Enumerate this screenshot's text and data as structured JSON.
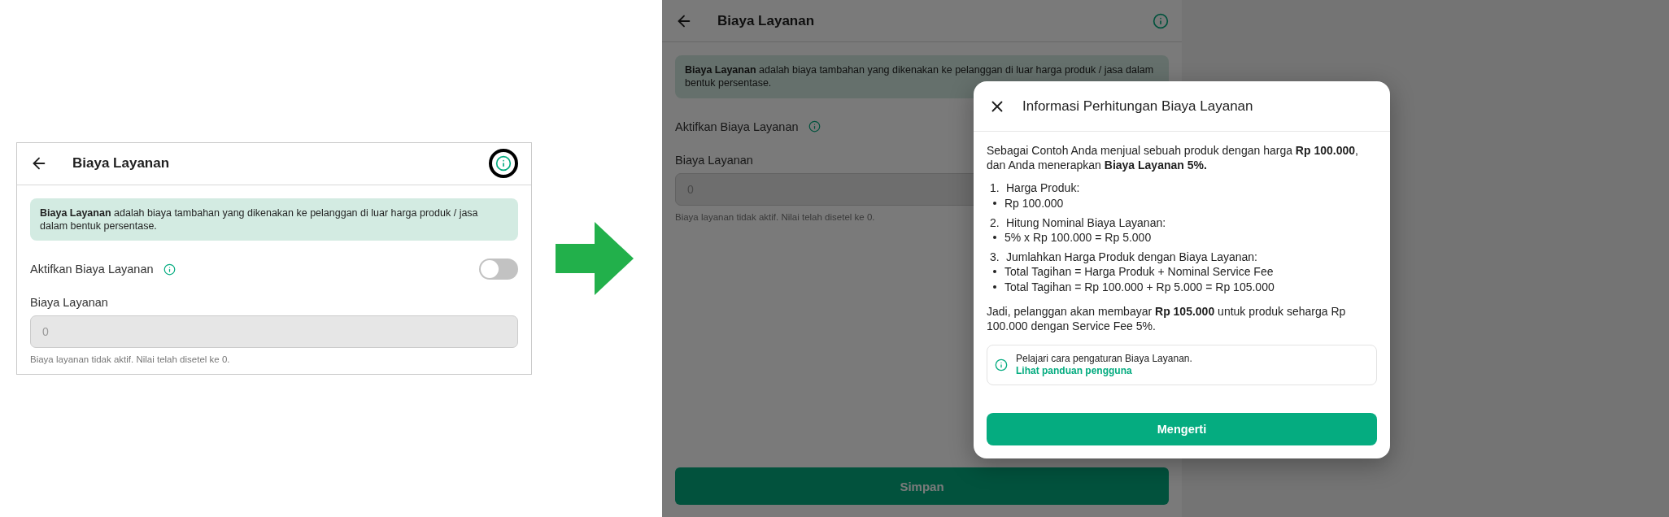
{
  "left_screen": {
    "header": {
      "title": "Biaya Layanan",
      "highlighted_info": true
    },
    "banner": "**Biaya Layanan** adalah biaya tambahan yang dikenakan ke pelanggan di luar harga produk / jasa dalam bentuk persentase.",
    "toggle": {
      "label": "Aktifkan Biaya Layanan",
      "on": false
    },
    "field": {
      "label": "Biaya Layanan",
      "placeholder": "0",
      "disabled": true
    },
    "helper": "Biaya layanan tidak aktif. Nilai telah disetel ke 0."
  },
  "right_screen": {
    "header": {
      "title": "Biaya Layanan",
      "highlighted_info": false
    },
    "banner": "**Biaya Layanan** adalah biaya tambahan yang dikenakan ke pelanggan di luar harga produk / jasa dalam bentuk persentase.",
    "toggle": {
      "label": "Aktifkan Biaya Layanan"
    },
    "field": {
      "label": "Biaya Layanan",
      "placeholder": "0",
      "disabled": true
    },
    "helper": "Biaya layanan tidak aktif. Nilai telah disetel ke 0.",
    "save_button": {
      "label": "Simpan"
    }
  },
  "dialog": {
    "title": "Informasi Perhitungan Biaya Layanan",
    "intro": "Sebagai Contoh Anda menjual sebuah produk dengan harga **Rp 100.000**, dan Anda menerapkan **Biaya Layanan 5%.**",
    "steps": [
      {
        "number": "1.",
        "title": "Harga Produk:",
        "bullets": [
          "Rp 100.000"
        ]
      },
      {
        "number": "2.",
        "title": "Hitung Nominal Biaya Layanan:",
        "bullets": [
          "5% x Rp 100.000 = Rp 5.000"
        ]
      },
      {
        "number": "3.",
        "title": "Jumlahkan Harga Produk dengan Biaya Layanan:",
        "bullets": [
          "Total Tagihan = Harga Produk + Nominal Service Fee",
          "Total Tagihan = Rp 100.000 + Rp 5.000 = Rp 105.000"
        ]
      }
    ],
    "conclusion": "Jadi, pelanggan akan membayar **Rp 105.000** untuk produk seharga Rp 100.000 dengan Service Fee 5%.",
    "callout": {
      "text": "Pelajari cara pengaturan Biaya Layanan.",
      "link": "Lihat panduan pengguna"
    },
    "button": "Mengerti"
  }
}
